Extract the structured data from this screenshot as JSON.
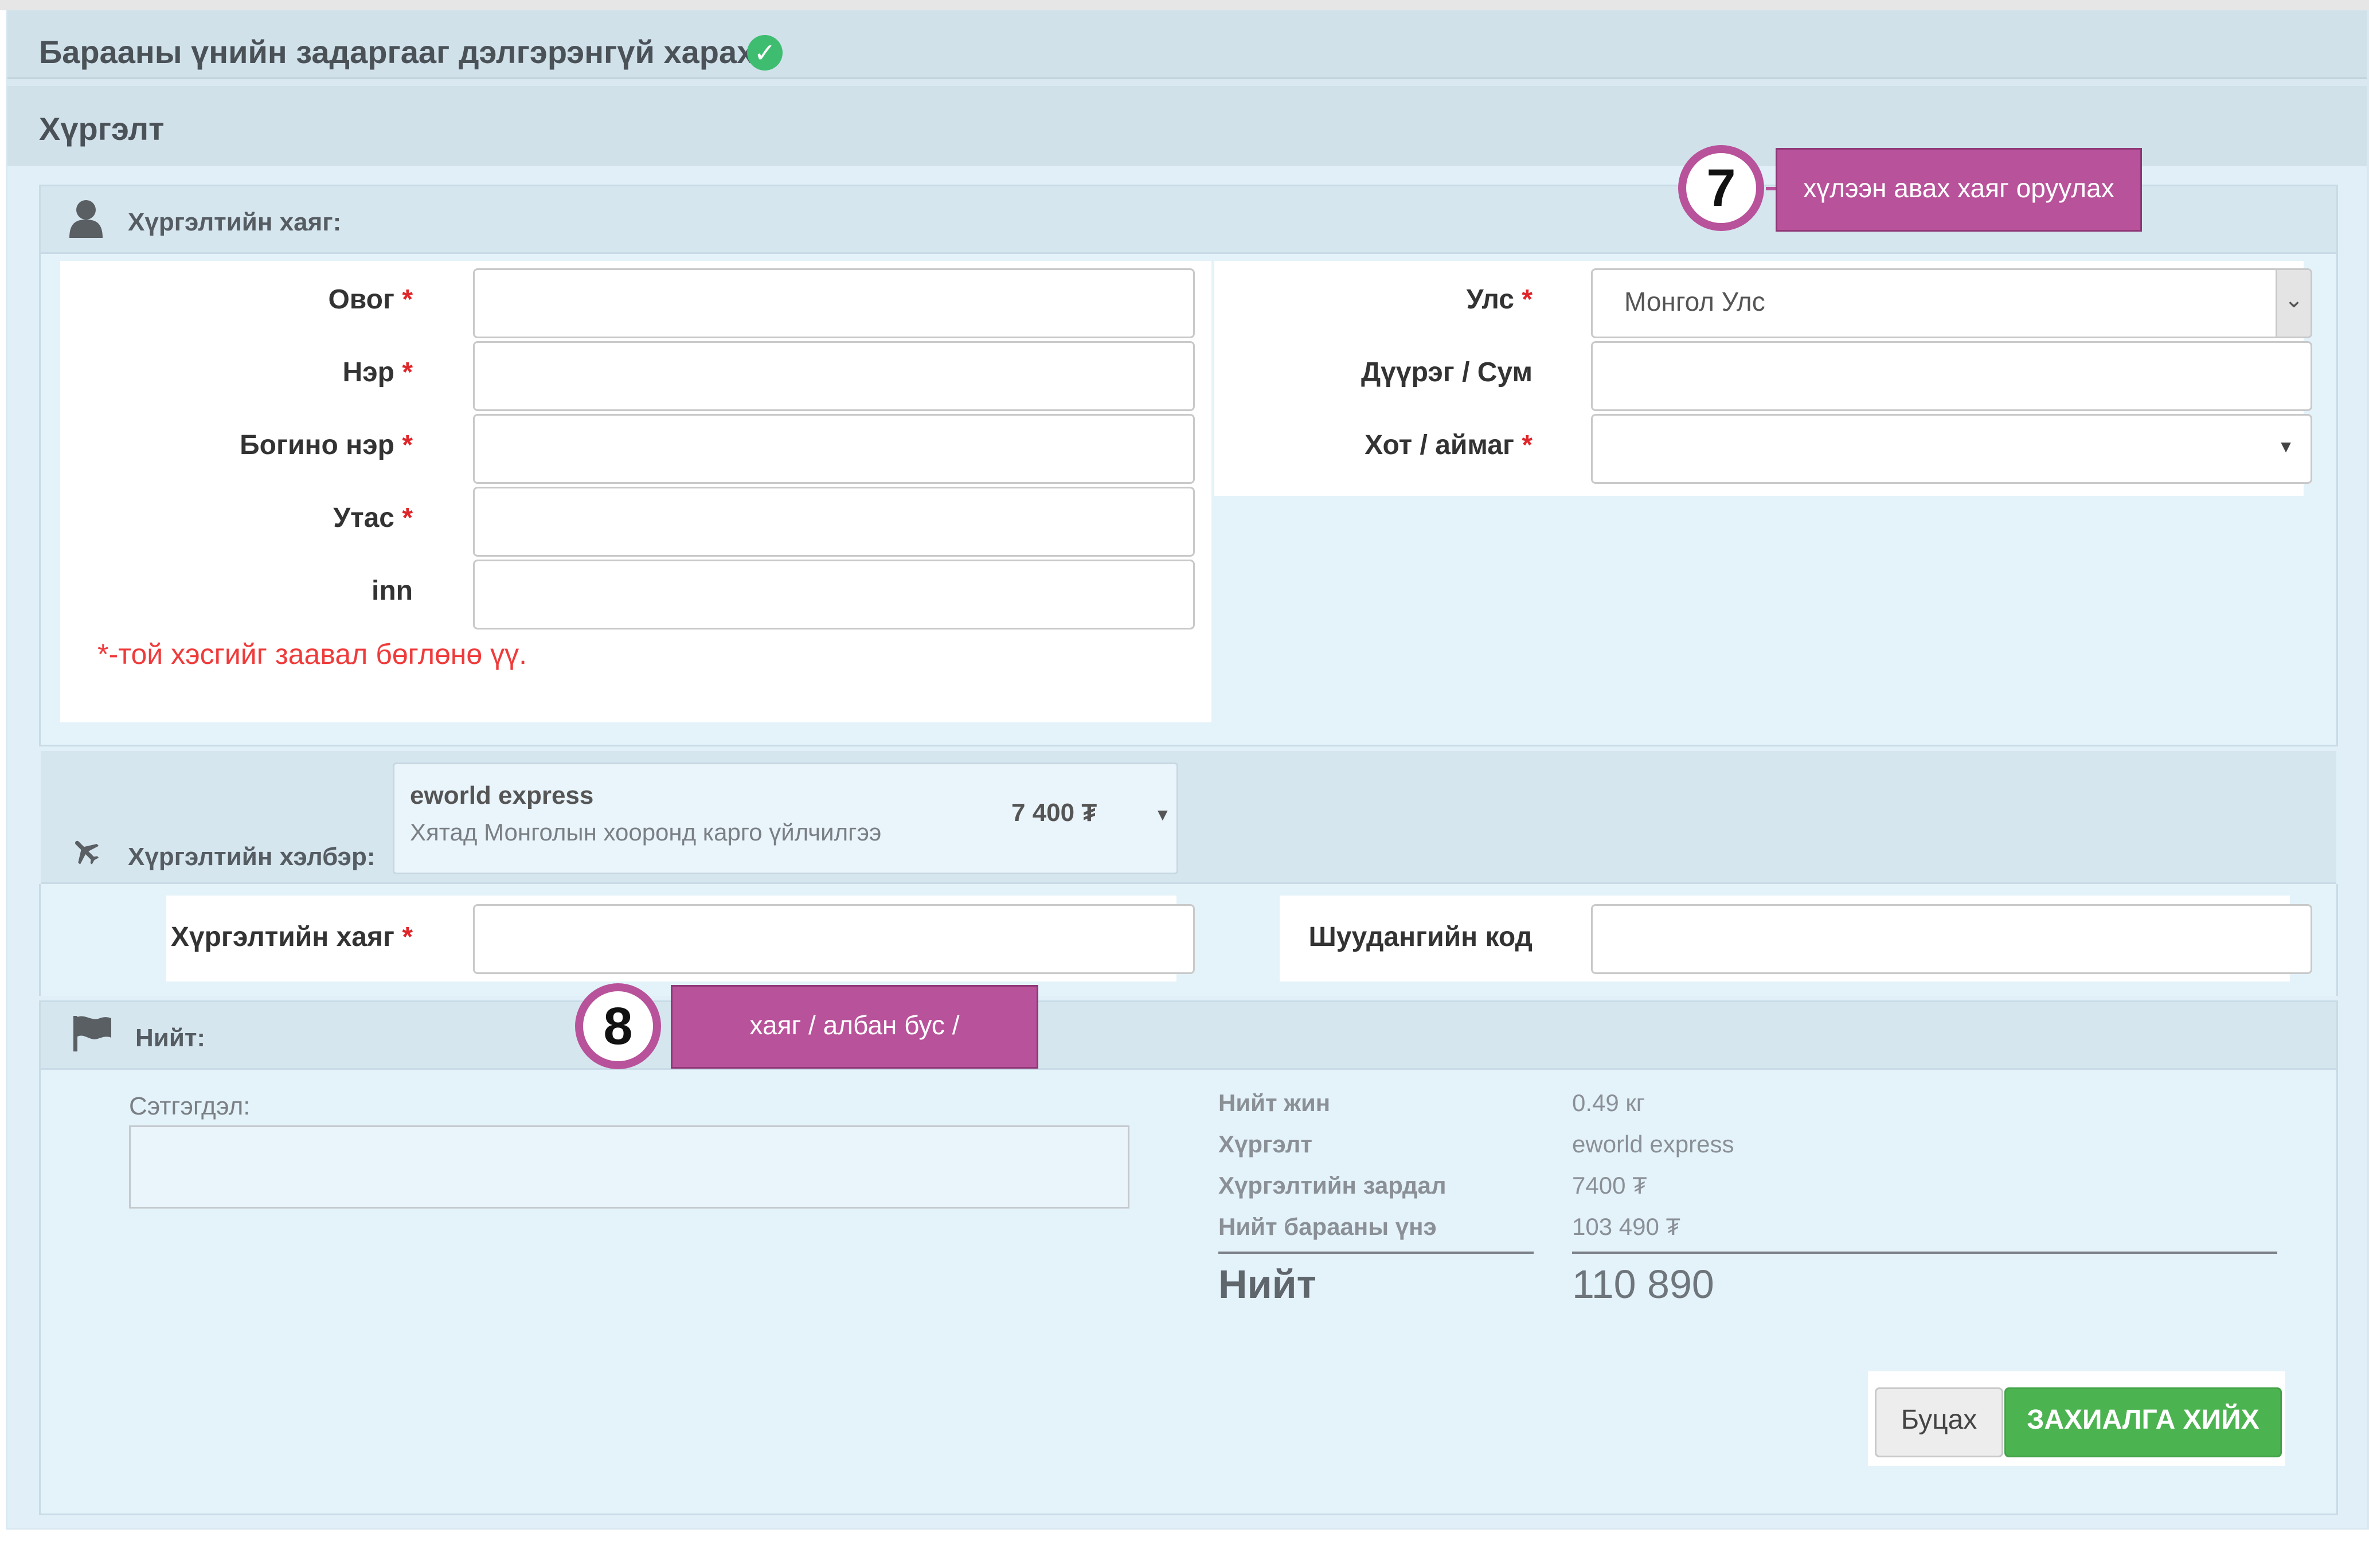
{
  "page_title": "Барааны үнийн задаргааг дэлгэрэнгүй харах",
  "section_title": "Хүргэлт",
  "address": {
    "heading": "Хүргэлтийн хаяг:",
    "fields": {
      "last_name": {
        "label": "Овог",
        "required": "*",
        "value": ""
      },
      "first_name": {
        "label": "Нэр",
        "required": "*",
        "value": ""
      },
      "short_name": {
        "label": "Богино нэр",
        "required": "*",
        "value": ""
      },
      "phone": {
        "label": "Утас",
        "required": "*",
        "value": ""
      },
      "inn": {
        "label": "inn",
        "value": ""
      },
      "country": {
        "label": "Улс",
        "required": "*",
        "value": "Монгол Улс"
      },
      "district": {
        "label": "Дүүрэг / Сум",
        "value": ""
      },
      "city": {
        "label": "Хот / аймаг",
        "required": "*",
        "value": ""
      }
    },
    "required_note": "*-той хэсгийг заавал бөглөнө үү."
  },
  "shipping": {
    "heading": "Хүргэлтийн хэлбэр:",
    "method_name": "eworld express",
    "method_desc": "Хятад Монголын хооронд карго үйлчилгээ",
    "method_price": "7 400 ₮",
    "address_label": "Хүргэлтийн хаяг",
    "address_required": "*",
    "postal_label": "Шуудангийн код"
  },
  "summary": {
    "heading": "Нийт:",
    "comment_label": "Сэтгэгдэл:",
    "rows": [
      {
        "label": "Нийт жин",
        "value": "0.49 кг"
      },
      {
        "label": "Хүргэлт",
        "value": "eworld express"
      },
      {
        "label": "Хүргэлтийн зардал",
        "value": "7400 ₮"
      },
      {
        "label": "Нийт барааны үнэ",
        "value": "103 490 ₮"
      }
    ],
    "total_label": "Нийт",
    "total_value": "110 890"
  },
  "buttons": {
    "back": "Буцах",
    "order": "ЗАХИАЛГА ХИЙХ"
  },
  "callouts": [
    {
      "number": "7",
      "text": "хүлээн авах хаяг оруулах"
    },
    {
      "number": "8",
      "text": "хаяг / албан бус /"
    }
  ],
  "colors": {
    "callout": "#b8529a",
    "order_button": "#4cb351",
    "required": "#e0262a",
    "check_badge": "#3ebd71"
  },
  "icons": [
    "check-circle-icon",
    "user-icon",
    "plane-icon",
    "flag-icon",
    "chevron-down-icon",
    "caret-down-icon"
  ]
}
